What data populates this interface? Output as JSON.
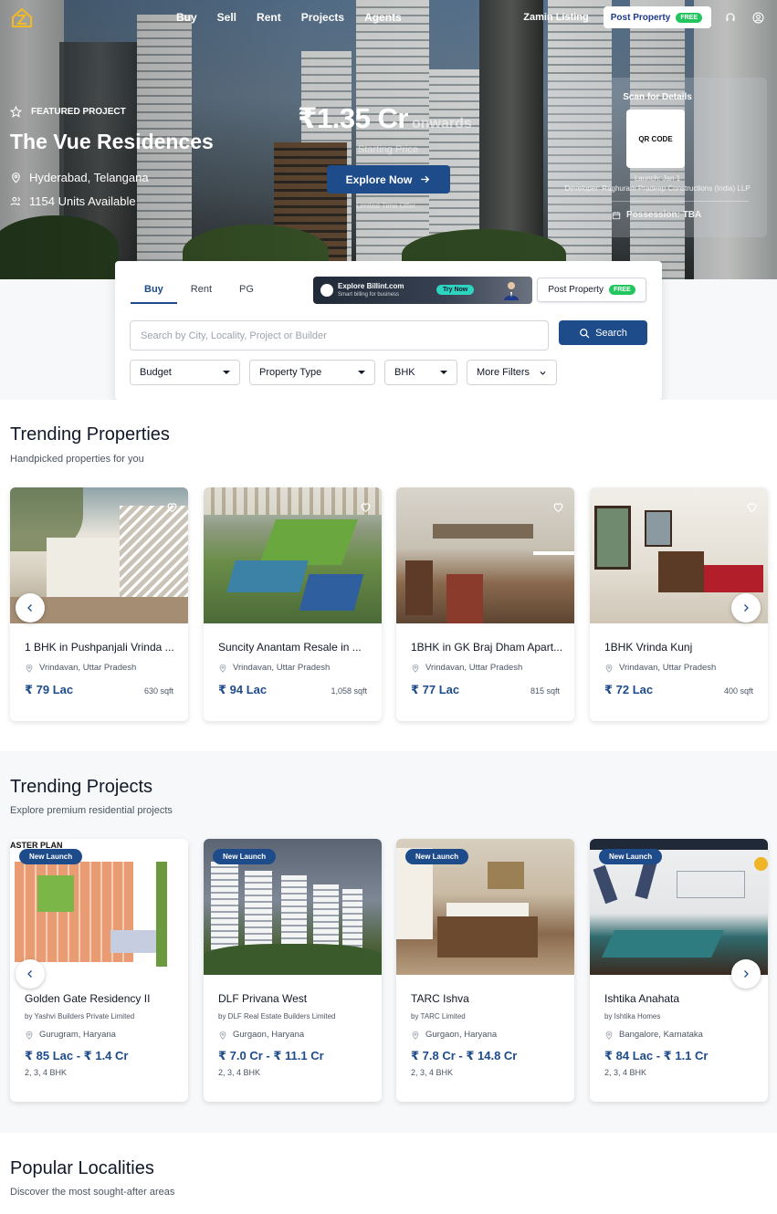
{
  "nav": {
    "links": [
      "Buy",
      "Sell",
      "Rent",
      "Projects",
      "Agents"
    ],
    "zamin_listing": "Zamin Listing",
    "post_property": "Post Property",
    "free": "FREE",
    "icons": [
      "headset-icon",
      "user-icon"
    ]
  },
  "hero": {
    "featured_label": "FEATURED PROJECT",
    "title": "The Vue Residences",
    "location": "Hyderabad, Telangana",
    "units": "1154 Units Available",
    "price": "₹1.35 Cr",
    "onwards": "onwards",
    "starting_price": "Starting Price",
    "explore_button": "Explore Now",
    "limited_offer": "Limited Time Offer",
    "qr": {
      "scan_label": "Scan for Details",
      "qr_text": "QR CODE",
      "launch": "Launch: Jan 1",
      "developer": "Developer: Raghuram Pradeep Constructions (India) LLP",
      "possession": "Possession: TBA"
    }
  },
  "search": {
    "tabs": [
      "Buy",
      "Rent",
      "PG"
    ],
    "active_tab": "Buy",
    "billint": {
      "title": "Explore Billint.com",
      "subtitle": "Smart billing for business",
      "cta": "Try Now"
    },
    "post_property": "Post Property",
    "free": "FREE",
    "placeholder": "Search by City, Locality, Project or Builder",
    "search_button": "Search",
    "filters": {
      "budget": "Budget",
      "property_type": "Property Type",
      "bhk": "BHK",
      "more_filters": "More Filters"
    }
  },
  "trending_properties": {
    "title": "Trending Properties",
    "subtitle": "Handpicked properties for you",
    "items": [
      {
        "title": "1 BHK in Pushpanjali Vrinda ...",
        "location": "Vrindavan, Uttar Pradesh",
        "price": "₹ 79 Lac",
        "area": "630 sqft"
      },
      {
        "title": "Suncity Anantam Resale in ...",
        "location": "Vrindavan, Uttar Pradesh",
        "price": "₹ 94 Lac",
        "area": "1,058 sqft"
      },
      {
        "title": "1BHK in GK Braj Dham Apart...",
        "location": "Vrindavan, Uttar Pradesh",
        "price": "₹ 77 Lac",
        "area": "815 sqft"
      },
      {
        "title": "1BHK Vrinda Kunj",
        "location": "Vrindavan, Uttar Pradesh",
        "price": "₹ 72 Lac",
        "area": "400 sqft"
      }
    ]
  },
  "trending_projects": {
    "title": "Trending Projects",
    "subtitle": "Explore premium residential projects",
    "badge": "New Launch",
    "items": [
      {
        "title": "Golden Gate Residency II",
        "developer": "by Yashvi Builders Private Limited",
        "location": "Gurugram, Haryana",
        "price": "₹ 85 Lac - ₹ 1.4 Cr",
        "bhk": "2, 3, 4 BHK",
        "image_text": "ASTER PLAN"
      },
      {
        "title": "DLF Privana West",
        "developer": "by DLF Real Estate Builders Limited",
        "location": "Gurgaon, Haryana",
        "price": "₹ 7.0 Cr - ₹ 11.1 Cr",
        "bhk": "2, 3, 4 BHK"
      },
      {
        "title": "TARC Ishva",
        "developer": "by TARC Limited",
        "location": "Gurgaon, Haryana",
        "price": "₹ 7.8 Cr - ₹ 14.8 Cr",
        "bhk": "2, 3, 4 BHK"
      },
      {
        "title": "Ishtika Anahata",
        "developer": "by Ishtika Homes",
        "location": "Bangalore, Karnataka",
        "price": "₹ 84 Lac - ₹ 1.1 Cr",
        "bhk": "2, 3, 4 BHK"
      }
    ]
  },
  "popular_localities": {
    "title": "Popular Localities",
    "subtitle": "Discover the most sought-after areas"
  },
  "colors": {
    "primary": "#1e4b8a",
    "free_badge": "#22c55e",
    "try_now": "#2dd4bf"
  }
}
